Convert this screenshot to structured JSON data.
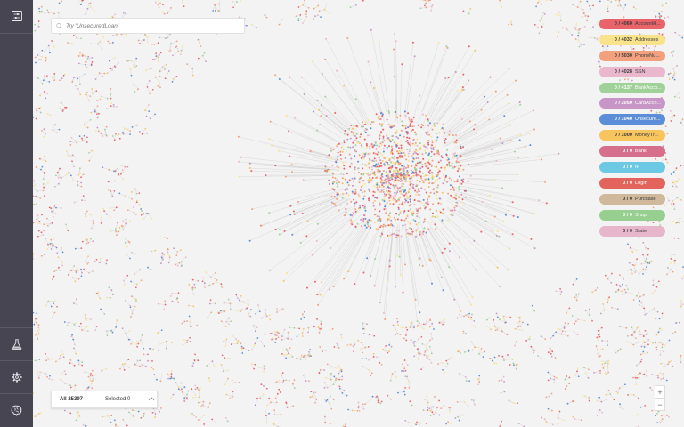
{
  "sidebar": {
    "top_icon": "filter-settings-icon",
    "bottom_icons": [
      "flask-icon",
      "gear-icon",
      "brain-icon"
    ]
  },
  "search": {
    "placeholder": "Try 'UnsecuredLoan'",
    "value": ""
  },
  "legend": [
    {
      "count": "0 / 4060",
      "label": "AccountH...",
      "color": "#e8636a",
      "dark": false
    },
    {
      "count": "0 / 4032",
      "label": "Addresses",
      "color": "#f9e38a",
      "dark": false
    },
    {
      "count": "0 / 5030",
      "label": "PhoneNu...",
      "color": "#f2a07e",
      "dark": false
    },
    {
      "count": "0 / 4028",
      "label": "SSN",
      "color": "#eab7cc",
      "dark": false
    },
    {
      "count": "0 / 4137",
      "label": "BankAcco...",
      "color": "#9fd199",
      "dark": true
    },
    {
      "count": "0 / 2050",
      "label": "CardAcco...",
      "color": "#c796c7",
      "dark": true
    },
    {
      "count": "0 / 1040",
      "label": "Unsecure...",
      "color": "#5b8ed6",
      "dark": true
    },
    {
      "count": "0 / 1000",
      "label": "MoneyTr...",
      "color": "#f7c45d",
      "dark": false
    },
    {
      "count": "0 / 0",
      "label": "Bank",
      "color": "#d56f8c",
      "dark": true
    },
    {
      "count": "0 / 0",
      "label": "IP",
      "color": "#6dc8e3",
      "dark": true
    },
    {
      "count": "0 / 0",
      "label": "Login",
      "color": "#e2645c",
      "dark": true
    },
    {
      "count": "0 / 0",
      "label": "Purchase",
      "color": "#cfb89b",
      "dark": false
    },
    {
      "count": "0 / 0",
      "label": "Shop",
      "color": "#97cf90",
      "dark": true
    },
    {
      "count": "0 / 0",
      "label": "State",
      "color": "#e8b6cb",
      "dark": false
    }
  ],
  "footer": {
    "all": "All 25397",
    "selected": "Selected 0"
  },
  "zoom": {
    "in": "+",
    "out": "−"
  }
}
